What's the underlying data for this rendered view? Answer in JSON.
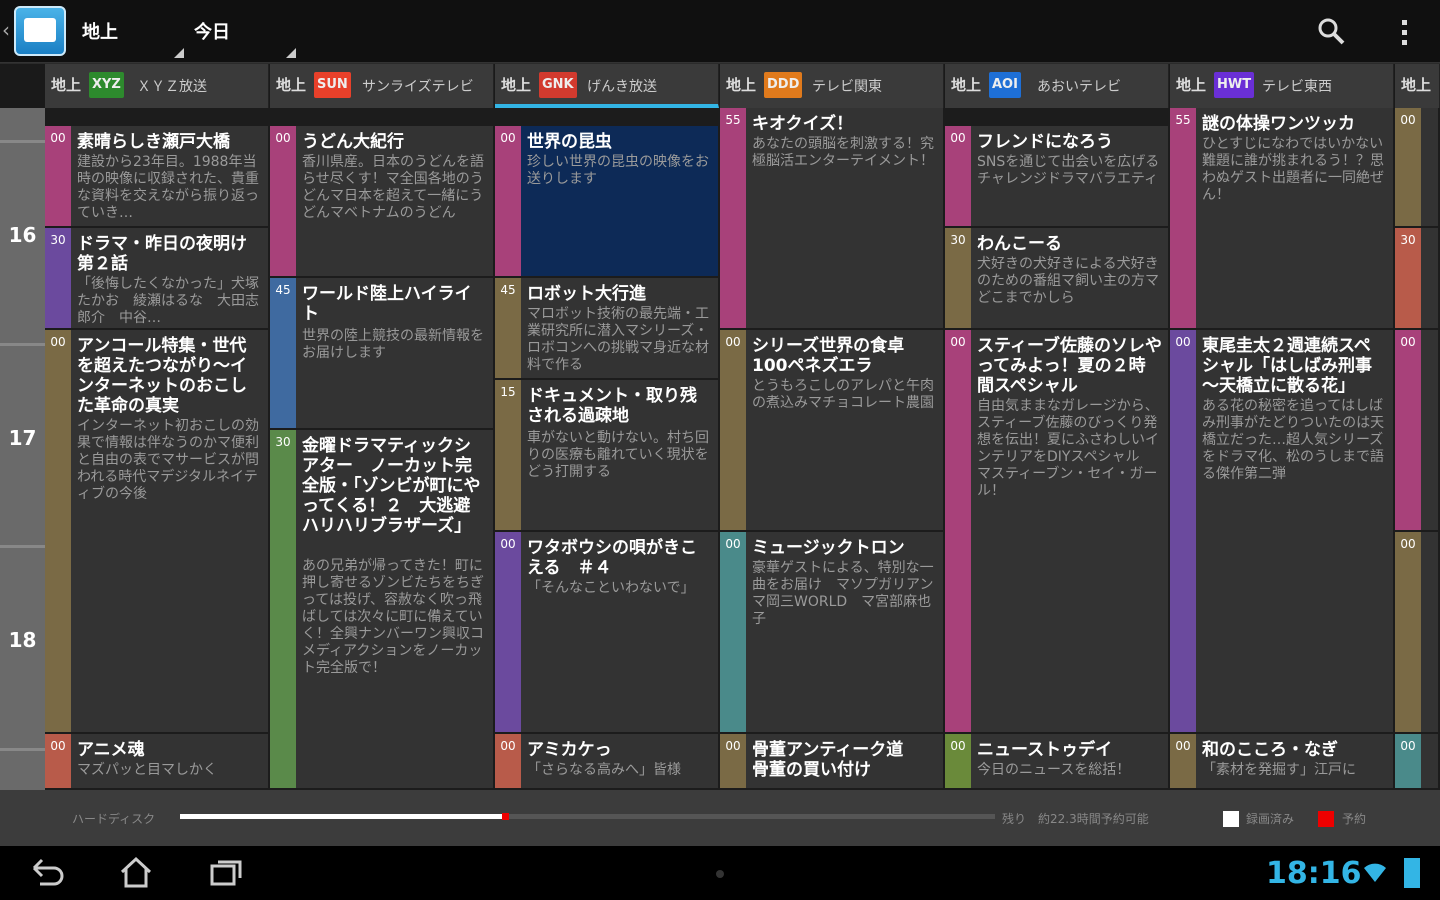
{
  "actionbar": {
    "spinner_broadcast": "地上",
    "spinner_day": "今日"
  },
  "channels": [
    {
      "band": "地上",
      "logo": "XYZ",
      "logo_color": "#2d8a2d",
      "name": "ＸＹＺ放送"
    },
    {
      "band": "地上",
      "logo": "SUN",
      "logo_color": "#e8402a",
      "name": "サンライズテレビ"
    },
    {
      "band": "地上",
      "logo": "GNK",
      "logo_color": "#d23a2e",
      "name": "げんき放送"
    },
    {
      "band": "地上",
      "logo": "DDD",
      "logo_color": "#e07a1c",
      "name": "テレビ関東"
    },
    {
      "band": "地上",
      "logo": "AOI",
      "logo_color": "#1e6fd6",
      "name": "あおいテレビ"
    },
    {
      "band": "地上",
      "logo": "HWT",
      "logo_color": "#6a2fd6",
      "name": "テレビ東西"
    },
    {
      "band": "地上",
      "logo": "",
      "logo_color": "#555555",
      "name": ""
    }
  ],
  "hours": [
    "16",
    "17",
    "18"
  ],
  "programs": [
    [
      {
        "min": "00",
        "title": "素晴らしき瀬戸大橋",
        "desc": "建設から23年目。1988年当時の映像に収録された、貴重な資料を交えながら振り返っていき…",
        "color": "#a8417a"
      },
      {
        "min": "30",
        "title": "ドラマ・昨日の夜明け　第２話",
        "desc": "「後悔したくなかった」犬塚たかお　綾瀬はるな　大田志郎介　中谷…",
        "color": "#6b4a9e"
      },
      {
        "min": "00",
        "title": "アンコール特集・世代を超えたつながり～インターネットのおこした革命の真実",
        "desc": "インターネット初おこしの効果で情報は伴なうのかマ便利と自由の表でマサービスが問われる時代マデジタルネイティブの今後",
        "color": "#7a6a45"
      },
      {
        "min": "00",
        "title": "アニメ魂",
        "desc": "マズパッと目マしかく",
        "color": "#b85b4a"
      }
    ],
    [
      {
        "min": "00",
        "title": "うどん大紀行",
        "desc": "香川県産。日本のうどんを語らせ尽くす！マ全国各地のうどんマ日本を超えて一緒にうどんマベトナムのうどん",
        "color": "#a8417a"
      },
      {
        "min": "45",
        "title": "ワールド陸上ハイライト",
        "desc": "世界の陸上競技の最新情報をお届けします",
        "color": "#3f6aa0"
      },
      {
        "min": "30",
        "title": "金曜ドラマティックシアター　ノーカット完全版・「ゾンビが町にやってくる！２　大逃避ハリハリブラザーズ」",
        "desc": "あの兄弟が帰ってきた！町に押し寄せるゾンビたちをちぎっては投げ、容赦なく吹っ飛ばしては次々に町に備えていく！全興ナンバーワン興収コメディアクションをノーカット完全版で！",
        "color": "#5a8a4a"
      }
    ],
    [
      {
        "min": "00",
        "title": "世界の昆虫",
        "desc": "珍しい世界の昆虫の映像をお送りします",
        "color": "#a8417a",
        "selected": true
      },
      {
        "min": "45",
        "title": "ロボット大行進",
        "desc": "マロボット技術の最先端・工業研究所に潜入マシリーズ・ロボコンへの挑戦マ身近な材料で作る",
        "color": "#7a6a45"
      },
      {
        "min": "15",
        "title": "ドキュメント・取り残される過疎地",
        "desc": "車がないと動けない。村ち回りの医療も離れていく現状をどう打開する",
        "color": "#7a6a45"
      },
      {
        "min": "00",
        "title": "ワタボウシの唄がきこえる　＃４",
        "desc": "「そんなこといわないで」",
        "color": "#6b4a9e"
      },
      {
        "min": "00",
        "title": "アミカケっ",
        "desc": "「さらなる高みへ」皆様",
        "color": "#b85b4a"
      }
    ],
    [
      {
        "min": "55",
        "title": "キオクイズ！",
        "desc": "あなたの頭脳を刺激する！究極脳活エンターテイメント！",
        "color": "#a8417a"
      },
      {
        "min": "00",
        "title": "シリーズ世界の食卓　100ペネズエラ",
        "desc": "とうもろこしのアレパと午肉の煮込みマチョコレート農園",
        "color": "#7a6a45"
      },
      {
        "min": "00",
        "title": "ミュージックトロン",
        "desc": "豪華ゲストによる、特別な一曲をお届け　マソプガリアン　マ岡三WORLD　マ宮部麻也子",
        "color": "#4a8a8a"
      },
      {
        "min": "00",
        "title": "骨董アンティーク道　骨董の買い付け",
        "desc": "",
        "color": "#7a6a45"
      }
    ],
    [
      {
        "min": "00",
        "title": "フレンドになろう",
        "desc": "SNSを通じて出会いを広げるチャレンジドラマバラエティ",
        "color": "#a8417a"
      },
      {
        "min": "30",
        "title": "わんこーる",
        "desc": "犬好きの犬好きによる犬好きのための番組マ飼い主の方マどこまでかしら",
        "color": "#7a6a45"
      },
      {
        "min": "00",
        "title": "スティーブ佐藤のソレやってみよっ！夏の２時間スペシャル",
        "desc": "自由気ままなガレージから、スティーブ佐藤のびっくり発想を伝出！夏にふさわしいインテリアをDIYスペシャル　マスティーブン・セイ・ガール！",
        "color": "#a8417a"
      },
      {
        "min": "00",
        "title": "ニューストゥデイ",
        "desc": "今日のニュースを総括！",
        "color": "#6a8a3a"
      }
    ],
    [
      {
        "min": "55",
        "title": "謎の体操ワンツッカ",
        "desc": "ひとすじになわではいかない難題に誰が挑まれるう！？思わぬゲスト出題者に一同絶ぜん！",
        "color": "#a8417a"
      },
      {
        "min": "00",
        "title": "東尾圭太２週連続スペシャル「はしばみ刑事～天橋立に散る花」",
        "desc": "ある花の秘密を追ってはしばみ刑事がたどりついたのは天橋立だった…超人気シリーズをドラマ化、松のうしまで語る傑作第二弾",
        "color": "#6b4a9e"
      },
      {
        "min": "00",
        "title": "和のこころ・なぎ",
        "desc": "「素材を発掘す」江戸に",
        "color": "#7a6a45"
      }
    ],
    [
      {
        "min": "00",
        "title": "",
        "desc": "",
        "color": "#7a6a45"
      },
      {
        "min": "30",
        "title": "",
        "desc": "",
        "color": "#b85b4a"
      },
      {
        "min": "00",
        "title": "",
        "desc": "",
        "color": "#a8417a"
      },
      {
        "min": "00",
        "title": "",
        "desc": "",
        "color": "#7a6a45"
      },
      {
        "min": "00",
        "title": "",
        "desc": "",
        "color": "#4a8a8a"
      }
    ]
  ],
  "storage": {
    "label": "ハードディスク",
    "remaining": "残り　約22.3時間予約可能",
    "used_fraction": 0.395,
    "legend_recorded": "録画済み",
    "legend_reserved": "予約"
  },
  "navbar": {
    "clock": "18:16"
  },
  "colors": {
    "accent": "#33b5e5",
    "selected_program": "#0d2a57",
    "reserved": "#e00000"
  }
}
